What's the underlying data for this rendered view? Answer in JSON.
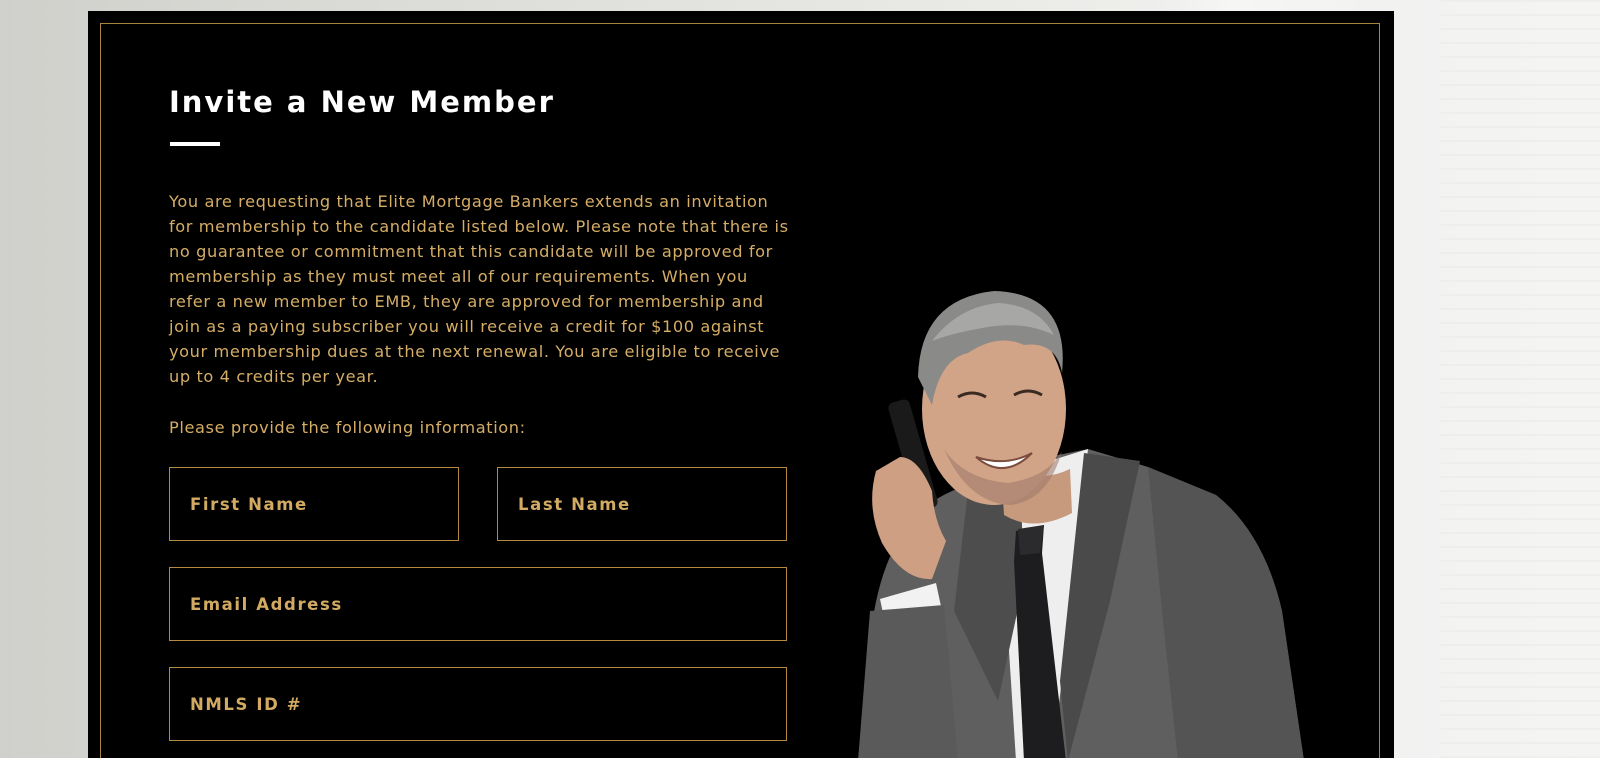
{
  "invite_form": {
    "title": "Invite a New Member",
    "intro_text": "You are requesting that Elite Mortgage Bankers extends an invitation for membership to the candidate listed below. Please note that there is no guarantee or commitment that this candidate will be approved for membership as they must meet all of our requirements. When you refer a new member to EMB, they are approved for membership and join as a paying subscriber you will receive a credit for $100 against your membership dues at the next renewal. You are eligible to receive up to 4 credits per year.",
    "prompt_text": "Please provide the following information:",
    "fields": {
      "first_name": {
        "placeholder": "First Name",
        "value": ""
      },
      "last_name": {
        "placeholder": "Last Name",
        "value": ""
      },
      "email": {
        "placeholder": "Email Address",
        "value": ""
      },
      "nmls_id": {
        "placeholder": "NMLS ID #",
        "value": ""
      }
    }
  },
  "colors": {
    "panel_background": "#000000",
    "accent_gold": "#d5ad66",
    "border_gold": "#b48b3f",
    "title_white": "#ffffff"
  }
}
